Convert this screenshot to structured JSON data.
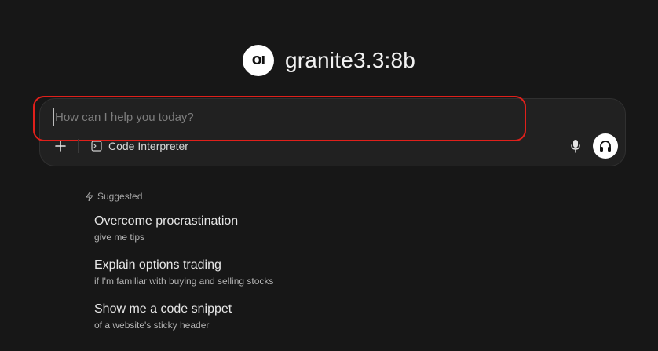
{
  "header": {
    "logo_text": "OI",
    "model_name": "granite3.3:8b"
  },
  "chat_input": {
    "placeholder": "How can I help you today?",
    "value": "",
    "tools": {
      "add_icon": "plus-icon",
      "code_interpreter_icon": "terminal-icon",
      "code_interpreter_label": "Code Interpreter",
      "mic_icon": "microphone-icon",
      "voice_icon": "headphones-icon"
    },
    "highlight_color": "#e0201b"
  },
  "suggested": {
    "label": "Suggested",
    "icon": "lightning-icon",
    "items": [
      {
        "title": "Overcome procrastination",
        "subtitle": "give me tips"
      },
      {
        "title": "Explain options trading",
        "subtitle": "if I'm familiar with buying and selling stocks"
      },
      {
        "title": "Show me a code snippet",
        "subtitle": "of a website's sticky header"
      }
    ]
  },
  "colors": {
    "background": "#171717",
    "input_background": "#212121",
    "text": "#ececec",
    "muted_text": "#a8a8a8"
  }
}
